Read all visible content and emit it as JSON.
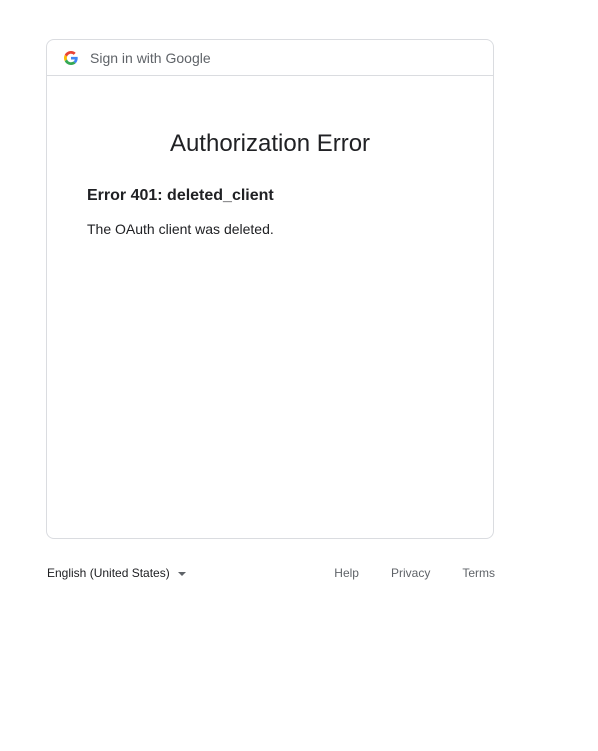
{
  "header": {
    "text": "Sign in with Google",
    "logo_icon": "google-g-logo-icon"
  },
  "main": {
    "title": "Authorization Error",
    "error_code": "Error 401: deleted_client",
    "error_description": "The OAuth client was deleted."
  },
  "footer": {
    "language": "English (United States)",
    "language_caret_icon": "caret-down-icon",
    "links": {
      "help": "Help",
      "privacy": "Privacy",
      "terms": "Terms"
    }
  },
  "colors": {
    "border": "#dadce0",
    "text_primary": "#202124",
    "text_secondary": "#5f6368",
    "google_blue": "#4285F4",
    "google_red": "#EA4335",
    "google_yellow": "#FBBC05",
    "google_green": "#34A853"
  }
}
